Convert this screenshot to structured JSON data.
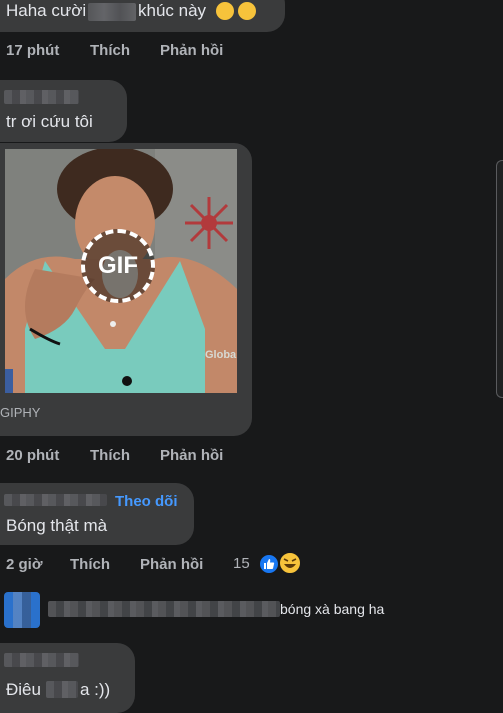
{
  "comments": [
    {
      "text_prefix": "Haha cười",
      "text_suffix": "khúc này",
      "time": "17 phút",
      "like_label": "Thích",
      "reply_label": "Phản hồi"
    },
    {
      "text": "tr ơi cứu tôi"
    },
    {
      "gif_badge": "GIF",
      "gif_watermark": "Globa",
      "gif_provider": "GIPHY",
      "time": "20 phút",
      "like_label": "Thích",
      "reply_label": "Phản hồi"
    },
    {
      "follow_label": "Theo dõi",
      "text": "Bóng thật mà",
      "time": "2 giờ",
      "like_label": "Thích",
      "reply_label": "Phản hồi",
      "reaction_count": "15"
    },
    {
      "reply_preview_suffix": "bóng xà bang ha"
    },
    {
      "text_prefix": "Điêu",
      "text_suffix": "a :))"
    }
  ],
  "colors": {
    "background": "#18191a",
    "bubble": "#3a3b3c",
    "text": "#e4e6eb",
    "meta": "#b0b3b8",
    "link": "#4599ff"
  },
  "icons": [
    "laugh-emoji-icon",
    "like-reaction-icon",
    "haha-reaction-icon",
    "gif-badge-icon"
  ]
}
